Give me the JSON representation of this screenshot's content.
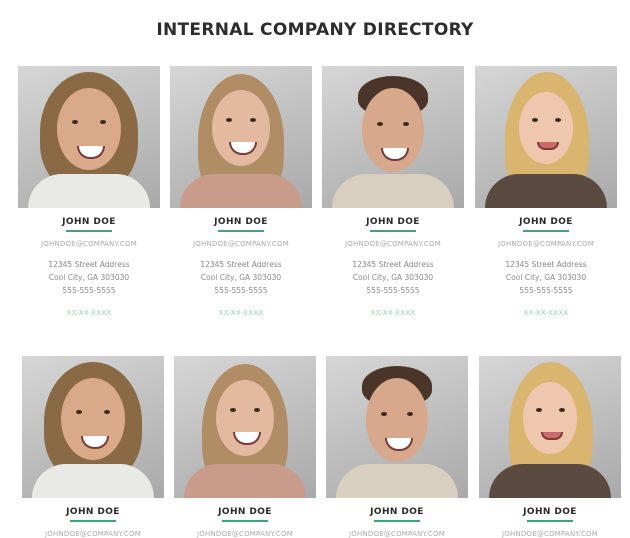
{
  "title": "INTERNAL COMPANY DIRECTORY",
  "accent_color": "#3fa377",
  "people": [
    {
      "name": "JOHN DOE",
      "email": "JOHNDOE@COMPANY.COM",
      "address_line1": "12345 Street Address",
      "address_line2": "Cool City, GA 303030",
      "phone": "555-555-5555",
      "extension": "XX-XX-XXXX"
    },
    {
      "name": "JOHN DOE",
      "email": "JOHNDOE@COMPANY.COM",
      "address_line1": "12345 Street Address",
      "address_line2": "Cool City, GA 303030",
      "phone": "555-555-5555",
      "extension": "XX-XX-XXXX"
    },
    {
      "name": "JOHN DOE",
      "email": "JOHNDOE@COMPANY.COM",
      "address_line1": "12345 Street Address",
      "address_line2": "Cool City, GA 303030",
      "phone": "555-555-5555",
      "extension": "XX-XX-XXXX"
    },
    {
      "name": "JOHN DOE",
      "email": "JOHNDOE@COMPANY.COM",
      "address_line1": "12345 Street Address",
      "address_line2": "Cool City, GA 303030",
      "phone": "555-555-5555",
      "extension": "XX-XX-XXXX"
    },
    {
      "name": "JOHN DOE",
      "email": "JOHNDOE@COMPANY.COM"
    },
    {
      "name": "JOHN DOE",
      "email": "JOHNDOE@COMPANY.COM"
    },
    {
      "name": "JOHN DOE",
      "email": "JOHNDOE@COMPANY.COM"
    },
    {
      "name": "JOHN DOE",
      "email": "JOHNDOE@COMPANY.COM"
    }
  ]
}
